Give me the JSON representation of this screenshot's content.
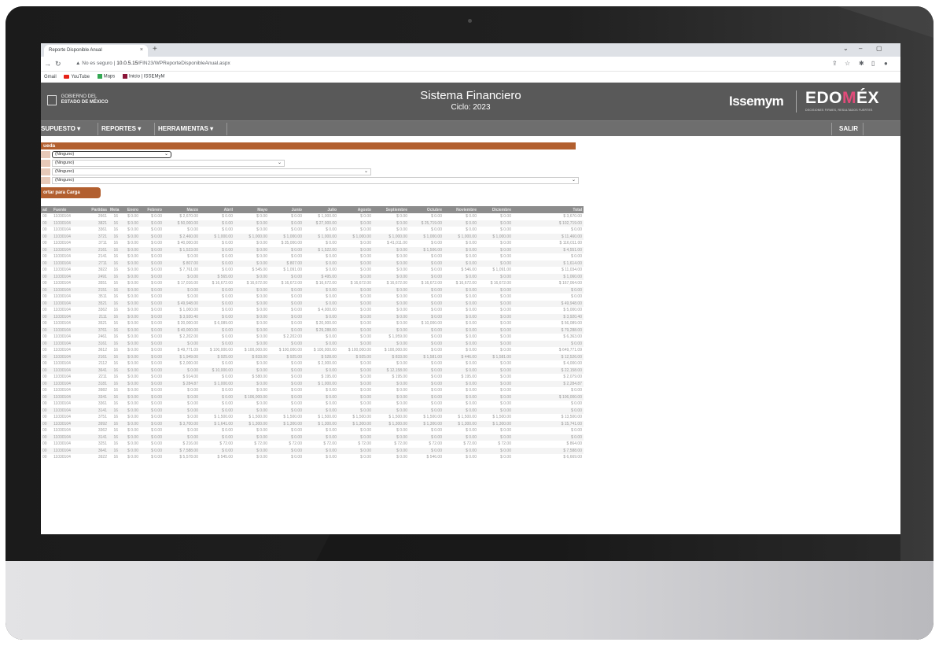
{
  "browser": {
    "tab_title": "Reporte Disponible Anual",
    "tab_close": "×",
    "new_tab": "+",
    "warning": "No es seguro",
    "url_host": "10.0.5.15",
    "url_path": "/FIN23/WPReporteDisponibleAnual.aspx",
    "bookmarks": [
      "Gmail",
      "YouTube",
      "Maps",
      "Inicio | ISSEMyM"
    ]
  },
  "header": {
    "gov_line1": "GOBIERNO DEL",
    "gov_line2": "ESTADO DE MÉXICO",
    "title": "Sistema Financiero",
    "cycle": "Ciclo: 2023",
    "brand1": "Issemym",
    "brand2_a": "EDO",
    "brand2_b": "M",
    "brand2_c": "ÉX",
    "brand2_sub": "DECISIONES FIRMES, RESULTADOS FUERTES"
  },
  "menu": {
    "items": [
      "SUPUESTO ▾",
      "REPORTES ▾",
      "HERRAMIENTAS ▾"
    ],
    "logout": "SALIR"
  },
  "search": {
    "title": "ueda",
    "filters": [
      "(Ninguno)",
      "(Ninguno)",
      "(Ninguno)",
      "(Ninguno)"
    ],
    "export_label": "ortar para Carga"
  },
  "table": {
    "columns": [
      "ad",
      "Fuente",
      "Partidas",
      "Meta",
      "Enero",
      "Febrero",
      "Marzo",
      "Abril",
      "Mayo",
      "Junio",
      "Julio",
      "Agosto",
      "Septiembre",
      "Octubre",
      "Noviembre",
      "Diciembre",
      "Total"
    ],
    "rows": [
      [
        "00",
        "11030104",
        "2661",
        "16",
        "$ 0.00",
        "$ 0.00",
        "$ 2,670.00",
        "$ 0.00",
        "$ 0.00",
        "$ 0.00",
        "$ 1,000.00",
        "$ 0.00",
        "$ 0.00",
        "$ 0.00",
        "$ 0.00",
        "$ 0.00",
        "$ 3,670.00"
      ],
      [
        "00",
        "11030104",
        "3821",
        "16",
        "$ 0.00",
        "$ 0.00",
        "$ 50,000.00",
        "$ 0.00",
        "$ 0.00",
        "$ 0.00",
        "$ 27,000.00",
        "$ 0.00",
        "$ 0.00",
        "$ 25,719.00",
        "$ 0.00",
        "$ 0.00",
        "$ 102,719.00"
      ],
      [
        "00",
        "11030104",
        "3361",
        "16",
        "$ 0.00",
        "$ 0.00",
        "$ 0.00",
        "$ 0.00",
        "$ 0.00",
        "$ 0.00",
        "$ 0.00",
        "$ 0.00",
        "$ 0.00",
        "$ 0.00",
        "$ 0.00",
        "$ 0.00",
        "$ 0.00"
      ],
      [
        "00",
        "11030104",
        "3721",
        "16",
        "$ 0.00",
        "$ 0.00",
        "$ 2,460.00",
        "$ 1,000.00",
        "$ 1,000.00",
        "$ 1,000.00",
        "$ 1,000.00",
        "$ 1,000.00",
        "$ 1,000.00",
        "$ 1,000.00",
        "$ 1,000.00",
        "$ 1,000.00",
        "$ 11,460.00"
      ],
      [
        "00",
        "11030104",
        "3711",
        "16",
        "$ 0.00",
        "$ 0.00",
        "$ 40,000.00",
        "$ 0.00",
        "$ 0.00",
        "$ 35,000.00",
        "$ 0.00",
        "$ 0.00",
        "$ 41,011.00",
        "$ 0.00",
        "$ 0.00",
        "$ 0.00",
        "$ 116,011.00"
      ],
      [
        "00",
        "11030104",
        "2161",
        "16",
        "$ 0.00",
        "$ 0.00",
        "$ 1,523.00",
        "$ 0.00",
        "$ 0.00",
        "$ 0.00",
        "$ 1,522.00",
        "$ 0.00",
        "$ 0.00",
        "$ 1,506.00",
        "$ 0.00",
        "$ 0.00",
        "$ 4,551.00"
      ],
      [
        "00",
        "11030104",
        "2141",
        "16",
        "$ 0.00",
        "$ 0.00",
        "$ 0.00",
        "$ 0.00",
        "$ 0.00",
        "$ 0.00",
        "$ 0.00",
        "$ 0.00",
        "$ 0.00",
        "$ 0.00",
        "$ 0.00",
        "$ 0.00",
        "$ 0.00"
      ],
      [
        "00",
        "11030104",
        "2711",
        "16",
        "$ 0.00",
        "$ 0.00",
        "$ 807.00",
        "$ 0.00",
        "$ 0.00",
        "$ 807.00",
        "$ 0.00",
        "$ 0.00",
        "$ 0.00",
        "$ 0.00",
        "$ 0.00",
        "$ 0.00",
        "$ 1,614.00"
      ],
      [
        "00",
        "11030104",
        "3922",
        "16",
        "$ 0.00",
        "$ 0.00",
        "$ 7,761.00",
        "$ 0.00",
        "$ 545.00",
        "$ 1,091.00",
        "$ 0.00",
        "$ 0.00",
        "$ 0.00",
        "$ 0.00",
        "$ 546.00",
        "$ 1,091.00",
        "$ 11,034.00"
      ],
      [
        "00",
        "11030104",
        "2491",
        "16",
        "$ 0.00",
        "$ 0.00",
        "$ 0.00",
        "$ 565.00",
        "$ 0.00",
        "$ 0.00",
        "$ 495.00",
        "$ 0.00",
        "$ 0.00",
        "$ 0.00",
        "$ 0.00",
        "$ 0.00",
        "$ 1,060.00"
      ],
      [
        "00",
        "11030104",
        "3551",
        "16",
        "$ 0.00",
        "$ 0.00",
        "$ 17,016.00",
        "$ 16,672.00",
        "$ 16,672.00",
        "$ 16,672.00",
        "$ 16,672.00",
        "$ 16,672.00",
        "$ 16,672.00",
        "$ 16,672.00",
        "$ 16,672.00",
        "$ 16,672.00",
        "$ 167,064.00"
      ],
      [
        "00",
        "11030104",
        "2151",
        "16",
        "$ 0.00",
        "$ 0.00",
        "$ 0.00",
        "$ 0.00",
        "$ 0.00",
        "$ 0.00",
        "$ 0.00",
        "$ 0.00",
        "$ 0.00",
        "$ 0.00",
        "$ 0.00",
        "$ 0.00",
        "$ 0.00"
      ],
      [
        "00",
        "11030104",
        "3511",
        "16",
        "$ 0.00",
        "$ 0.00",
        "$ 0.00",
        "$ 0.00",
        "$ 0.00",
        "$ 0.00",
        "$ 0.00",
        "$ 0.00",
        "$ 0.00",
        "$ 0.00",
        "$ 0.00",
        "$ 0.00",
        "$ 0.00"
      ],
      [
        "00",
        "11030104",
        "3521",
        "16",
        "$ 0.00",
        "$ 0.00",
        "$ 49,948.00",
        "$ 0.00",
        "$ 0.00",
        "$ 0.00",
        "$ 0.00",
        "$ 0.00",
        "$ 0.00",
        "$ 0.00",
        "$ 0.00",
        "$ 0.00",
        "$ 49,948.00"
      ],
      [
        "00",
        "11030104",
        "3362",
        "16",
        "$ 0.00",
        "$ 0.00",
        "$ 1,000.00",
        "$ 0.00",
        "$ 0.00",
        "$ 0.00",
        "$ 4,000.00",
        "$ 0.00",
        "$ 0.00",
        "$ 0.00",
        "$ 0.00",
        "$ 0.00",
        "$ 5,000.00"
      ],
      [
        "00",
        "11030104",
        "2111",
        "16",
        "$ 0.00",
        "$ 0.00",
        "$ 3,920.40",
        "$ 0.00",
        "$ 0.00",
        "$ 0.00",
        "$ 0.00",
        "$ 0.00",
        "$ 0.00",
        "$ 0.00",
        "$ 0.00",
        "$ 0.00",
        "$ 3,920.40"
      ],
      [
        "00",
        "11030104",
        "3521",
        "16",
        "$ 0.00",
        "$ 0.00",
        "$ 20,000.00",
        "$ 6,089.00",
        "$ 0.00",
        "$ 0.00",
        "$ 20,000.00",
        "$ 0.00",
        "$ 0.00",
        "$ 10,000.00",
        "$ 0.00",
        "$ 0.00",
        "$ 56,089.00"
      ],
      [
        "00",
        "11030104",
        "3761",
        "16",
        "$ 0.00",
        "$ 0.00",
        "$ 40,000.00",
        "$ 0.00",
        "$ 0.00",
        "$ 0.00",
        "$ 29,288.00",
        "$ 0.00",
        "$ 0.00",
        "$ 0.00",
        "$ 0.00",
        "$ 0.00",
        "$ 79,288.00"
      ],
      [
        "00",
        "11030104",
        "2461",
        "16",
        "$ 0.00",
        "$ 0.00",
        "$ 2,202.00",
        "$ 0.00",
        "$ 0.00",
        "$ 2,202.00",
        "$ 0.00",
        "$ 0.00",
        "$ 1,959.00",
        "$ 0.00",
        "$ 0.00",
        "$ 0.00",
        "$ 6,363.00"
      ],
      [
        "00",
        "11030104",
        "3161",
        "16",
        "$ 0.00",
        "$ 0.00",
        "$ 0.00",
        "$ 0.00",
        "$ 0.00",
        "$ 0.00",
        "$ 0.00",
        "$ 0.00",
        "$ 0.00",
        "$ 0.00",
        "$ 0.00",
        "$ 0.00",
        "$ 0.00"
      ],
      [
        "00",
        "11030104",
        "3612",
        "16",
        "$ 0.00",
        "$ 0.00",
        "$ 49,771.09",
        "$ 100,000.00",
        "$ 100,000.00",
        "$ 100,000.00",
        "$ 100,000.00",
        "$ 100,000.00",
        "$ 100,000.00",
        "$ 0.00",
        "$ 0.00",
        "$ 0.00",
        "$ 649,771.09"
      ],
      [
        "00",
        "11030104",
        "2161",
        "16",
        "$ 0.00",
        "$ 0.00",
        "$ 1,949.00",
        "$ 925.00",
        "$ 833.00",
        "$ 925.00",
        "$ 528.00",
        "$ 925.00",
        "$ 833.00",
        "$ 1,581.00",
        "$ 446.00",
        "$ 1,581.00",
        "$ 12,526.00"
      ],
      [
        "00",
        "11030104",
        "2112",
        "16",
        "$ 0.00",
        "$ 0.00",
        "$ 2,000.00",
        "$ 0.00",
        "$ 0.00",
        "$ 0.00",
        "$ 2,000.00",
        "$ 0.00",
        "$ 0.00",
        "$ 0.00",
        "$ 0.00",
        "$ 0.00",
        "$ 4,000.00"
      ],
      [
        "00",
        "11030104",
        "3641",
        "16",
        "$ 0.00",
        "$ 0.00",
        "$ 0.00",
        "$ 10,000.00",
        "$ 0.00",
        "$ 0.00",
        "$ 0.00",
        "$ 0.00",
        "$ 12,158.00",
        "$ 0.00",
        "$ 0.00",
        "$ 0.00",
        "$ 22,158.00"
      ],
      [
        "00",
        "11030104",
        "2211",
        "16",
        "$ 0.00",
        "$ 0.00",
        "$ 914.00",
        "$ 0.00",
        "$ 580.00",
        "$ 0.00",
        "$ 195.00",
        "$ 0.00",
        "$ 195.00",
        "$ 0.00",
        "$ 195.00",
        "$ 0.00",
        "$ 2,079.00"
      ],
      [
        "00",
        "11030104",
        "3181",
        "16",
        "$ 0.00",
        "$ 0.00",
        "$ 284.87",
        "$ 1,000.00",
        "$ 0.00",
        "$ 0.00",
        "$ 1,000.00",
        "$ 0.00",
        "$ 0.00",
        "$ 0.00",
        "$ 0.00",
        "$ 0.00",
        "$ 2,284.87"
      ],
      [
        "00",
        "11030104",
        "3982",
        "16",
        "$ 0.00",
        "$ 0.00",
        "$ 0.00",
        "$ 0.00",
        "$ 0.00",
        "$ 0.00",
        "$ 0.00",
        "$ 0.00",
        "$ 0.00",
        "$ 0.00",
        "$ 0.00",
        "$ 0.00",
        "$ 0.00"
      ],
      [
        "00",
        "11030104",
        "3341",
        "16",
        "$ 0.00",
        "$ 0.00",
        "$ 0.00",
        "$ 0.00",
        "$ 106,000.00",
        "$ 0.00",
        "$ 0.00",
        "$ 0.00",
        "$ 0.00",
        "$ 0.00",
        "$ 0.00",
        "$ 0.00",
        "$ 106,000.00"
      ],
      [
        "00",
        "11030104",
        "3361",
        "16",
        "$ 0.00",
        "$ 0.00",
        "$ 0.00",
        "$ 0.00",
        "$ 0.00",
        "$ 0.00",
        "$ 0.00",
        "$ 0.00",
        "$ 0.00",
        "$ 0.00",
        "$ 0.00",
        "$ 0.00",
        "$ 0.00"
      ],
      [
        "00",
        "11030104",
        "3141",
        "16",
        "$ 0.00",
        "$ 0.00",
        "$ 0.00",
        "$ 0.00",
        "$ 0.00",
        "$ 0.00",
        "$ 0.00",
        "$ 0.00",
        "$ 0.00",
        "$ 0.00",
        "$ 0.00",
        "$ 0.00",
        "$ 0.00"
      ],
      [
        "00",
        "11030104",
        "3751",
        "16",
        "$ 0.00",
        "$ 0.00",
        "$ 0.00",
        "$ 1,500.00",
        "$ 1,500.00",
        "$ 1,500.00",
        "$ 1,500.00",
        "$ 1,500.00",
        "$ 1,500.00",
        "$ 1,500.00",
        "$ 1,500.00",
        "$ 1,500.00",
        "$ 13,500.00"
      ],
      [
        "00",
        "11030104",
        "3992",
        "16",
        "$ 0.00",
        "$ 0.00",
        "$ 3,700.00",
        "$ 1,641.00",
        "$ 1,300.00",
        "$ 1,300.00",
        "$ 1,300.00",
        "$ 1,300.00",
        "$ 1,300.00",
        "$ 1,300.00",
        "$ 1,300.00",
        "$ 1,300.00",
        "$ 15,741.00"
      ],
      [
        "00",
        "11030104",
        "3362",
        "16",
        "$ 0.00",
        "$ 0.00",
        "$ 0.00",
        "$ 0.00",
        "$ 0.00",
        "$ 0.00",
        "$ 0.00",
        "$ 0.00",
        "$ 0.00",
        "$ 0.00",
        "$ 0.00",
        "$ 0.00",
        "$ 0.00"
      ],
      [
        "00",
        "11030104",
        "3141",
        "16",
        "$ 0.00",
        "$ 0.00",
        "$ 0.00",
        "$ 0.00",
        "$ 0.00",
        "$ 0.00",
        "$ 0.00",
        "$ 0.00",
        "$ 0.00",
        "$ 0.00",
        "$ 0.00",
        "$ 0.00",
        "$ 0.00"
      ],
      [
        "00",
        "11030104",
        "3251",
        "16",
        "$ 0.00",
        "$ 0.00",
        "$ 216.00",
        "$ 72.00",
        "$ 72.00",
        "$ 72.00",
        "$ 72.00",
        "$ 72.00",
        "$ 72.00",
        "$ 72.00",
        "$ 72.00",
        "$ 72.00",
        "$ 864.00"
      ],
      [
        "00",
        "11030104",
        "3641",
        "16",
        "$ 0.00",
        "$ 0.00",
        "$ 7,588.00",
        "$ 0.00",
        "$ 0.00",
        "$ 0.00",
        "$ 0.00",
        "$ 0.00",
        "$ 0.00",
        "$ 0.00",
        "$ 0.00",
        "$ 0.00",
        "$ 7,588.00"
      ],
      [
        "00",
        "11030104",
        "3922",
        "16",
        "$ 0.00",
        "$ 0.00",
        "$ 5,578.00",
        "$ 545.00",
        "$ 0.00",
        "$ 0.00",
        "$ 0.00",
        "$ 0.00",
        "$ 0.00",
        "$ 546.00",
        "$ 0.00",
        "$ 0.00",
        "$ 6,669.00"
      ]
    ]
  },
  "colors": {
    "header_bg": "#595959",
    "menu_bg": "#6e6e6e",
    "accent": "#b25f2f",
    "table_header": "#8c8c8c"
  }
}
